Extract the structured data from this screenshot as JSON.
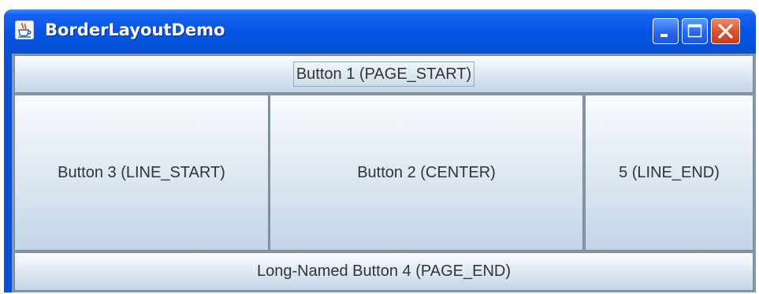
{
  "window": {
    "title": "BorderLayoutDemo",
    "app_icon": "java-cup-icon",
    "controls": {
      "minimize_icon": "minimize-icon",
      "maximize_icon": "maximize-icon",
      "close_icon": "close-icon"
    }
  },
  "buttons": {
    "page_start": "Button 1 (PAGE_START)",
    "line_start": "Button 3 (LINE_START)",
    "center": "Button 2 (CENTER)",
    "line_end": "5 (LINE_END)",
    "page_end": "Long-Named Button 4 (PAGE_END)"
  },
  "colors": {
    "titlebar": "#0552dd",
    "close_button": "#d9502c",
    "button_face_top": "#fafcfe",
    "button_face_bottom": "#c3d5e6",
    "button_text": "#333333"
  }
}
